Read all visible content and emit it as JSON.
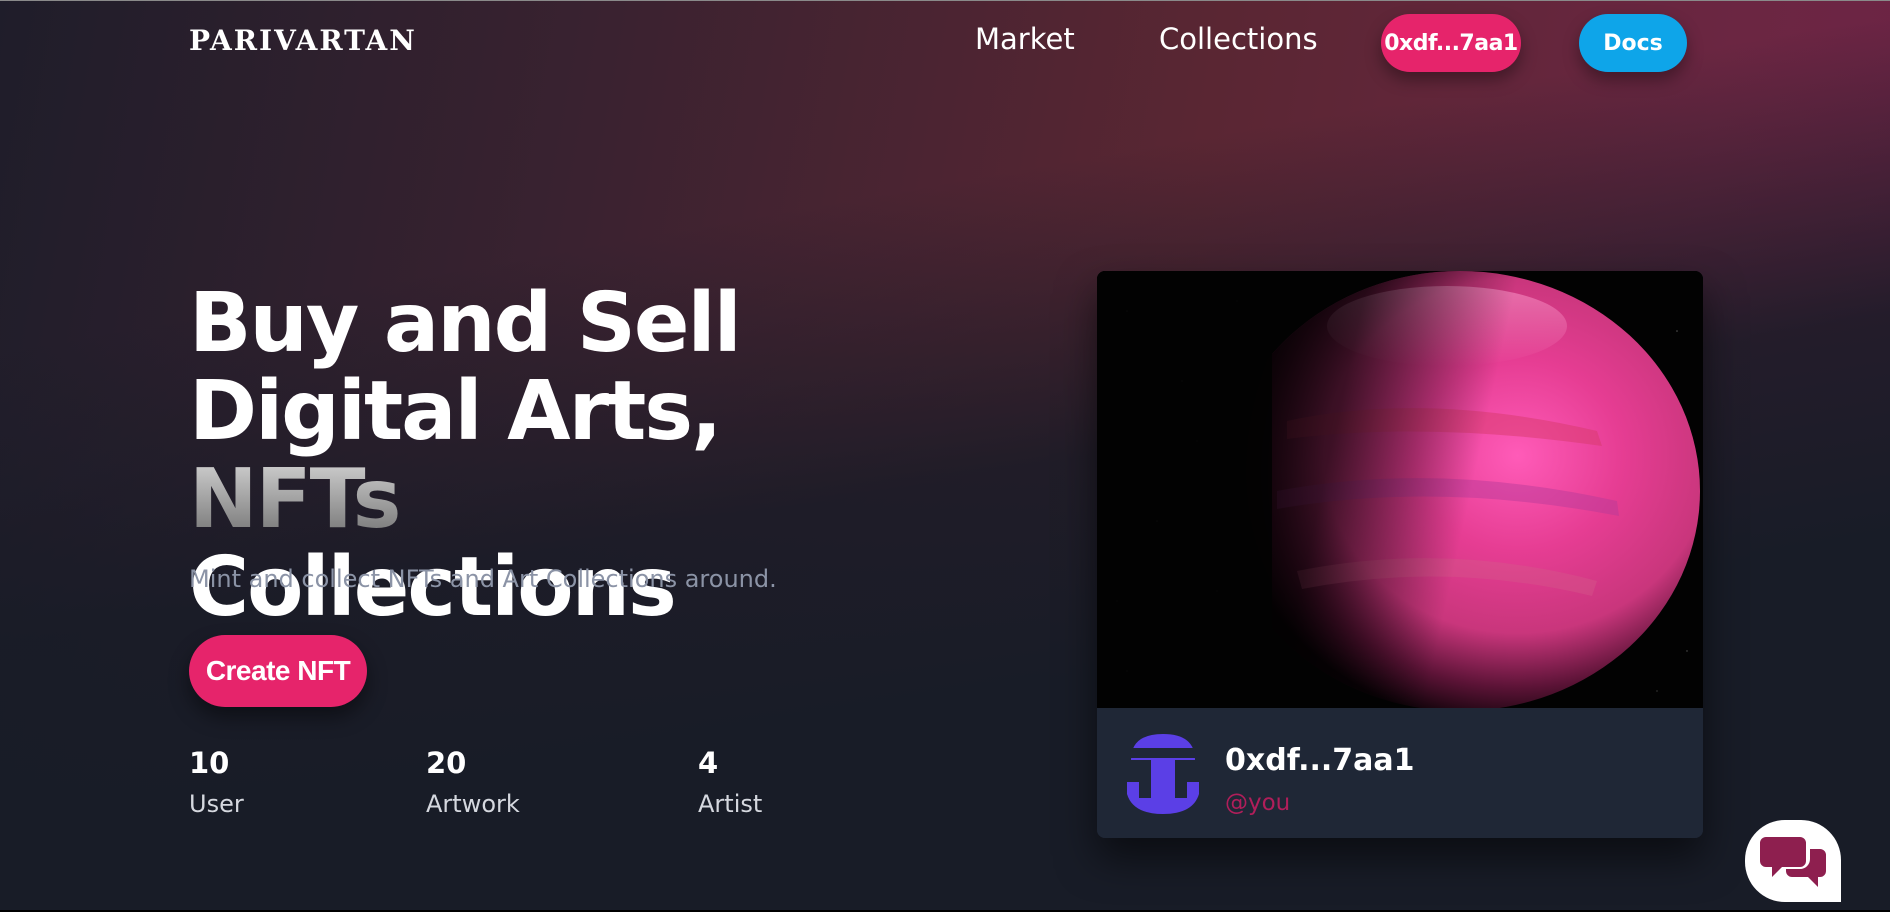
{
  "header": {
    "logo": "PARIVARTAN",
    "nav": {
      "market": "Market",
      "collections": "Collections"
    },
    "wallet_button": "0xdf...7aa1",
    "docs_button": "Docs"
  },
  "hero": {
    "title_line1": "Buy and Sell",
    "title_line2": "Digital Arts,",
    "title_line3_highlight": "NFTs",
    "title_line3_rest": "Collections",
    "subtitle": "Mint and collect NFTs and Art Collections around.",
    "create_button": "Create NFT",
    "stats": [
      {
        "value": "10",
        "label": "User"
      },
      {
        "value": "20",
        "label": "Artwork"
      },
      {
        "value": "4",
        "label": "Artist"
      }
    ]
  },
  "card": {
    "owner": "0xdf...7aa1",
    "handle": "@you",
    "icons": {
      "avatar": "avatar-icon",
      "image": "pink-planet-artwork"
    }
  },
  "chat": {
    "icon": "chat-bubbles-icon"
  },
  "colors": {
    "accent_pink": "#e6246b",
    "accent_blue": "#0ea5e9",
    "avatar_purple": "#5b3fe6",
    "handle_color": "#b01e5a"
  }
}
